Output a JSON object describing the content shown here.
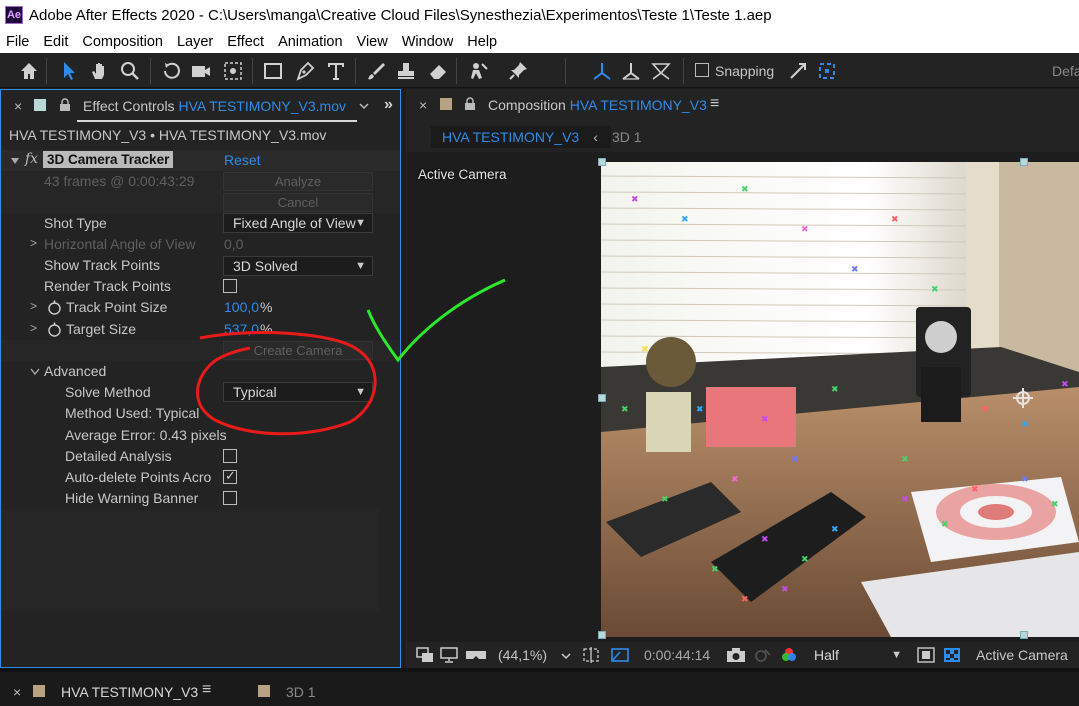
{
  "window": {
    "app_icon": "Ae",
    "title": "Adobe After Effects 2020 - C:\\Users\\manga\\Creative Cloud Files\\Synesthezia\\Experimentos\\Teste 1\\Teste 1.aep"
  },
  "menu": [
    "File",
    "Edit",
    "Composition",
    "Layer",
    "Effect",
    "Animation",
    "View",
    "Window",
    "Help"
  ],
  "toolbar": {
    "tools": [
      "home-icon",
      "selection-tool-icon",
      "hand-tool-icon",
      "zoom-tool-icon",
      "rotate-tool-icon",
      "camera-tool-icon",
      "pan-behind-tool-icon",
      "rectangle-tool-icon",
      "pen-tool-icon",
      "type-tool-icon",
      "brush-tool-icon",
      "clone-stamp-tool-icon",
      "eraser-tool-icon",
      "roto-brush-tool-icon",
      "puppet-pin-tool-icon",
      "local-axis-icon",
      "world-axis-icon",
      "view-axis-icon"
    ],
    "snapping_label": "Snapping",
    "workspace_label": "Defa"
  },
  "effect_controls": {
    "tab_prefix": "Effect Controls",
    "tab_layer": "HVA TESTIMONY_V3.mov",
    "header": "HVA TESTIMONY_V3 • HVA TESTIMONY_V3.mov",
    "effect_name": "3D Camera Tracker",
    "reset_label": "Reset",
    "frames_info": "43 frames @ 0:00:43:29",
    "analyze_label": "Analyze",
    "cancel_label": "Cancel",
    "shot_type_label": "Shot Type",
    "shot_type_value": "Fixed Angle of View",
    "horizontal_angle_label": "Horizontal Angle of View",
    "horizontal_angle_value": "0,0",
    "show_track_points_label": "Show Track Points",
    "show_track_points_value": "3D Solved",
    "render_track_points_label": "Render Track Points",
    "render_track_points_checked": false,
    "track_point_size_label": "Track Point Size",
    "track_point_size_value": "100,0",
    "track_point_size_unit": "%",
    "target_size_label": "Target Size",
    "target_size_value": "537,0",
    "target_size_unit": "%",
    "create_camera_label": "Create Camera",
    "advanced_label": "Advanced",
    "solve_method_label": "Solve Method",
    "solve_method_value": "Typical",
    "method_used_label": "Method Used: Typical",
    "average_error_label": "Average Error: 0.43 pixels",
    "detailed_analysis_label": "Detailed Analysis",
    "detailed_analysis_checked": false,
    "auto_delete_label": "Auto-delete Points Acro",
    "auto_delete_checked": true,
    "hide_warning_label": "Hide Warning Banner",
    "hide_warning_checked": false
  },
  "composition": {
    "tab_prefix": "Composition",
    "tab_name": "HVA TESTIMONY_V3",
    "viewer_tab_active": "HVA TESTIMONY_V3",
    "viewer_tab_inactive": "3D 1",
    "active_camera_overlay": "Active Camera",
    "zoom": "(44,1%)",
    "timecode": "0:00:44:14",
    "resolution": "Half",
    "camera_view": "Active Camera"
  },
  "timeline_tabs": {
    "tab1": "HVA TESTIMONY_V3",
    "tab2": "3D 1"
  },
  "colors": {
    "accent": "#2d8ceb",
    "panel_bg": "#232323",
    "annotation_red": "#e81b1b",
    "annotation_green": "#2be82b"
  }
}
